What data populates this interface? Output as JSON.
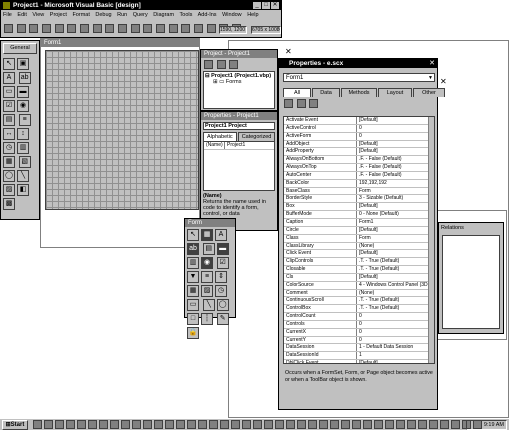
{
  "main_window": {
    "title": "Project1 - Microsoft Visual Basic [design]",
    "menu": [
      "File",
      "Edit",
      "View",
      "Project",
      "Format",
      "Debug",
      "Run",
      "Query",
      "Diagram",
      "Tools",
      "Add-Ins",
      "Window",
      "Help"
    ],
    "position_readout": "1590, 1200",
    "size_readout": "6705 x 10080"
  },
  "toolbox": {
    "title": "General"
  },
  "form_designer": {
    "title": "Form1"
  },
  "project_explorer": {
    "title": "Project - Project1",
    "root": "Project1 (Project1.vbp)",
    "folder": "Forms"
  },
  "properties_vb": {
    "title": "Properties - Project1",
    "object": "Project1  Project",
    "tabs": [
      "Alphabetic",
      "Categorized"
    ],
    "row_name": "(Name)",
    "row_value": "Project1",
    "desc_title": "(Name)",
    "desc_text": "Returns the name used in code to identify a form, control, or data"
  },
  "form_toolbar": {
    "label": "Form"
  },
  "vfp_properties": {
    "title": "Properties - e.scx",
    "object": "Form1",
    "tabs": [
      "All",
      "Data",
      "Methods",
      "Layout",
      "Other"
    ],
    "rows": [
      [
        "Activate Event",
        "[Default]"
      ],
      [
        "ActiveControl",
        "0"
      ],
      [
        "ActiveForm",
        "0"
      ],
      [
        "AddObject",
        "[Default]"
      ],
      [
        "AddProperty",
        "[Default]"
      ],
      [
        "AlwaysOnBottom",
        ".F. - False (Default)"
      ],
      [
        "AlwaysOnTop",
        ".F. - False (Default)"
      ],
      [
        "AutoCenter",
        ".F. - False (Default)"
      ],
      [
        "BackColor",
        "192,192,192"
      ],
      [
        "BaseClass",
        "Form"
      ],
      [
        "BorderStyle",
        "3 - Sizable (Default)"
      ],
      [
        "Box",
        "[Default]"
      ],
      [
        "BufferMode",
        "0 - None (Default)"
      ],
      [
        "Caption",
        "Form1"
      ],
      [
        "Circle",
        "[Default]"
      ],
      [
        "Class",
        "Form"
      ],
      [
        "ClassLibrary",
        "(None)"
      ],
      [
        "Click Event",
        "[Default]"
      ],
      [
        "ClipControls",
        ".T. - True (Default)"
      ],
      [
        "Closable",
        ".T. - True (Default)"
      ],
      [
        "Cls",
        "[Default]"
      ],
      [
        "ColorSource",
        "4 - Windows Control Panel (3D C"
      ],
      [
        "Comment",
        "(None)"
      ],
      [
        "ContinuousScroll",
        ".T. - True (Default)"
      ],
      [
        "ControlBox",
        ".T. - True (Default)"
      ],
      [
        "ControlCount",
        "0"
      ],
      [
        "Controls",
        "0"
      ],
      [
        "CurrentX",
        "0"
      ],
      [
        "CurrentY",
        "0"
      ],
      [
        "DataSession",
        "1 - Default Data Session"
      ],
      [
        "DataSessionId",
        "1"
      ],
      [
        "DblClick Event",
        "[Default]"
      ]
    ],
    "description": "Occurs when a FormSet, Form, or Page object becomes active or when a ToolBar object is shown."
  },
  "relations_panel": {
    "label": "Relations"
  },
  "taskbar": {
    "start": "Start",
    "clock": "9:19 AM"
  }
}
